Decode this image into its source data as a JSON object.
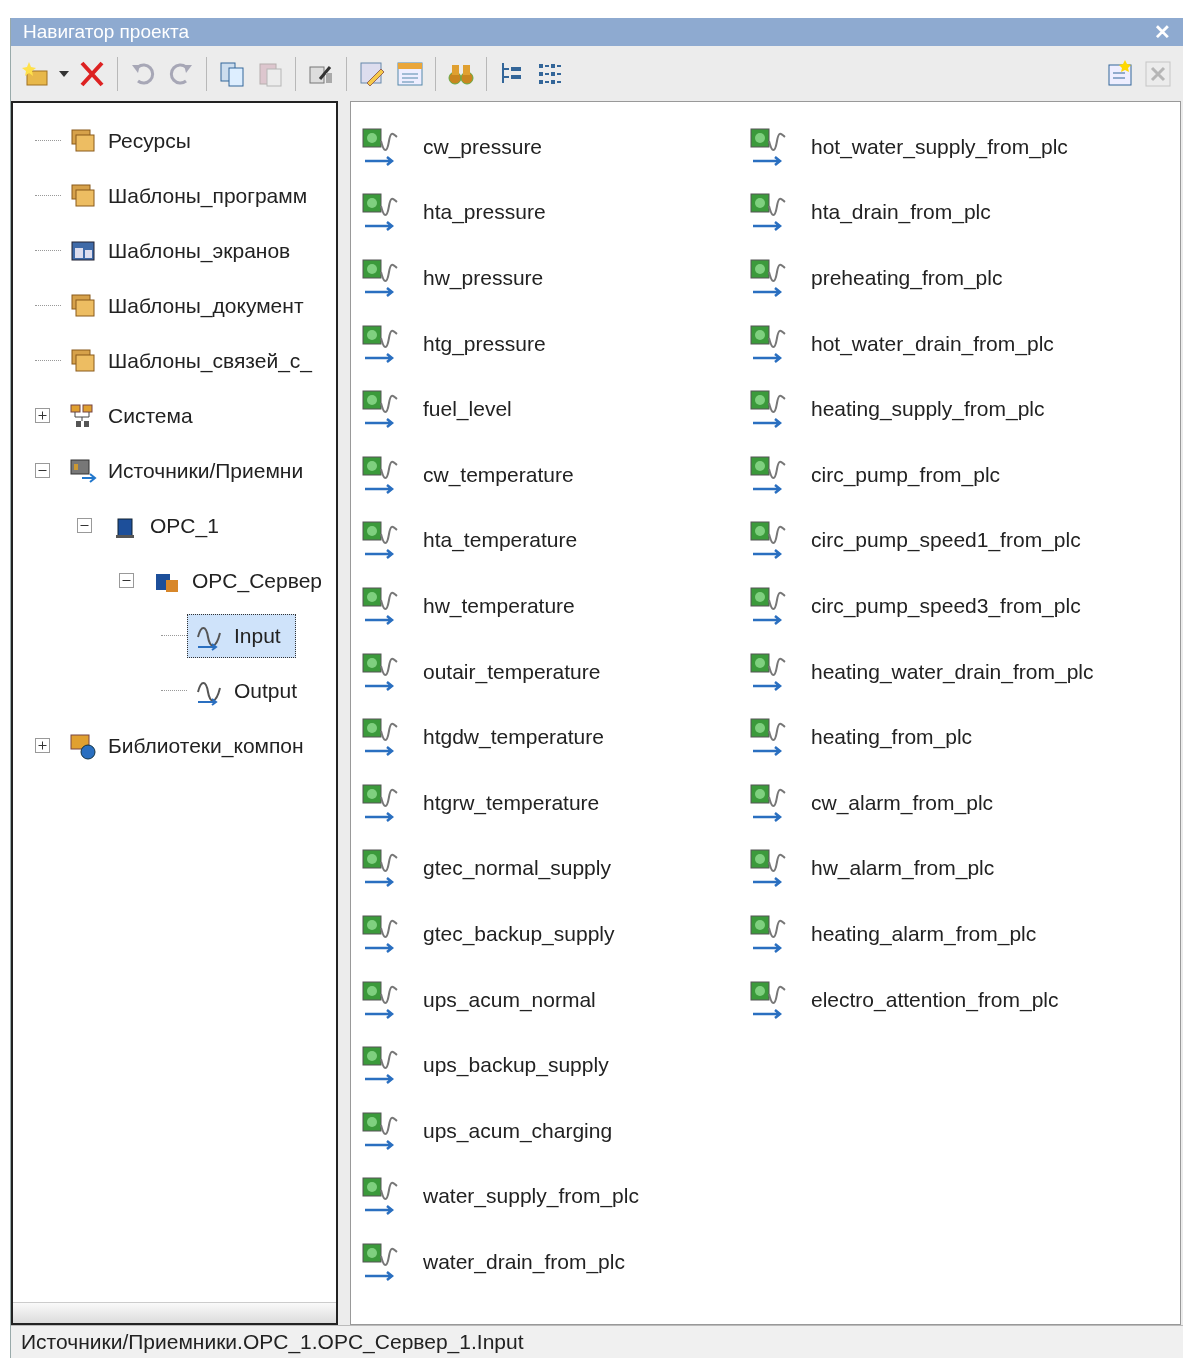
{
  "window": {
    "title": "Навигатор проекта",
    "close": "✕"
  },
  "toolbar": [
    {
      "kind": "new",
      "disabled": false
    },
    {
      "kind": "dropdown",
      "disabled": false
    },
    {
      "kind": "delete",
      "disabled": false
    },
    {
      "kind": "sep"
    },
    {
      "kind": "undo",
      "disabled": true
    },
    {
      "kind": "redo",
      "disabled": true
    },
    {
      "kind": "sep"
    },
    {
      "kind": "copy",
      "disabled": false
    },
    {
      "kind": "paste",
      "disabled": true
    },
    {
      "kind": "sep"
    },
    {
      "kind": "rename",
      "disabled": false
    },
    {
      "kind": "sep"
    },
    {
      "kind": "edit",
      "disabled": false
    },
    {
      "kind": "props",
      "disabled": false
    },
    {
      "kind": "sep"
    },
    {
      "kind": "find",
      "disabled": false
    },
    {
      "kind": "sep"
    },
    {
      "kind": "tree",
      "disabled": false
    },
    {
      "kind": "list",
      "disabled": false
    },
    {
      "kind": "spacer"
    },
    {
      "kind": "newwin",
      "disabled": false
    },
    {
      "kind": "closepane",
      "disabled": true
    }
  ],
  "tree": [
    {
      "label": "Ресурсы",
      "kind": "folder",
      "selected": false
    },
    {
      "label": "Шаблоны_программ",
      "kind": "folder",
      "selected": false
    },
    {
      "label": "Шаблоны_экранов",
      "kind": "screens",
      "selected": false
    },
    {
      "label": "Шаблоны_документ",
      "kind": "folder",
      "selected": false
    },
    {
      "label": "Шаблоны_связей_с_",
      "kind": "folder",
      "selected": false
    },
    {
      "label": "Система",
      "kind": "network",
      "selected": false,
      "expanded": false
    },
    {
      "label": "Источники/Приемни",
      "kind": "sources",
      "selected": false,
      "expanded": true,
      "children": [
        {
          "label": "OPC_1",
          "kind": "opc",
          "selected": false,
          "expanded": true,
          "children": [
            {
              "label": "OPC_Сервер",
              "kind": "opcserver",
              "selected": false,
              "expanded": true,
              "children": [
                {
                  "label": "Input",
                  "kind": "signal",
                  "selected": true
                },
                {
                  "label": "Output",
                  "kind": "signal",
                  "selected": false
                }
              ]
            }
          ]
        }
      ]
    },
    {
      "label": "Библиотеки_компон",
      "kind": "library",
      "selected": false,
      "expanded": false
    }
  ],
  "items": [
    "cw_pressure",
    "hta_pressure",
    "hw_pressure",
    "htg_pressure",
    "fuel_level",
    "cw_temperature",
    "hta_temperature",
    "hw_temperature",
    "outair_temperature",
    "htgdw_temperature",
    "htgrw_temperature",
    "gtec_normal_supply",
    "gtec_backup_supply",
    "ups_acum_normal",
    "ups_backup_supply",
    "ups_acum_charging",
    "water_supply_from_plc",
    "water_drain_from_plc",
    "hot_water_supply_from_plc",
    "hta_drain_from_plc",
    "preheating_from_plc",
    "hot_water_drain_from_plc",
    "heating_supply_from_plc",
    "circ_pump_from_plc",
    "circ_pump_speed1_from_plc",
    "circ_pump_speed3_from_plc",
    "heating_water_drain_from_plc",
    "heating_from_plc",
    "cw_alarm_from_plc",
    "hw_alarm_from_plc",
    "heating_alarm_from_plc",
    "electro_attention_from_plc"
  ],
  "status_bar": "Источники/Приемники.OPC_1.OPC_Сервер_1.Input"
}
